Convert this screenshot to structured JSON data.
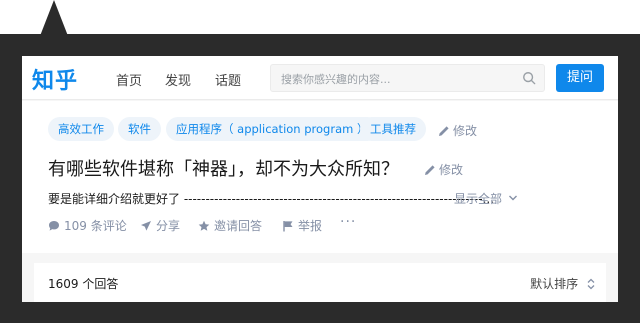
{
  "header": {
    "logo": "知乎",
    "nav": [
      "首页",
      "发现",
      "话题"
    ],
    "search_placeholder": "搜索你感兴趣的内容...",
    "ask_label": "提问"
  },
  "question": {
    "tags": [
      "高效工作",
      "软件",
      "应用程序（ application program ）",
      "工具推荐"
    ],
    "edit_label": "修改",
    "title": "有哪些软件堪称「神器」，却不为大众所知？",
    "description": "要是能详细介绍就更好了 ---------------------------------------------------------------------...",
    "show_all": "显示全部",
    "actions": {
      "comments": "109 条评论",
      "share": "分享",
      "invite": "邀请回答",
      "report": "举报",
      "more": "···"
    }
  },
  "answers": {
    "count": "1609 个回答",
    "sort": "默认排序"
  },
  "colors": {
    "brand": "#0f88eb",
    "frame": "#2b2b2b",
    "muted": "#8590a6"
  }
}
